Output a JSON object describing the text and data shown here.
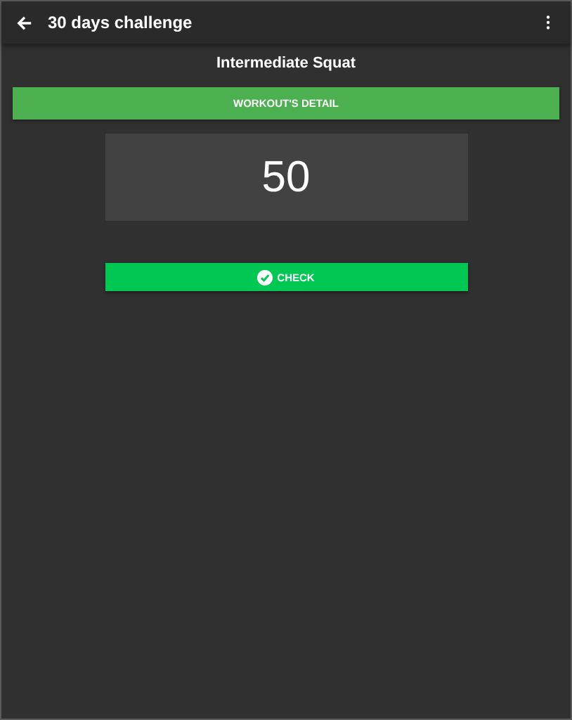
{
  "toolbar": {
    "title": "30 days challenge"
  },
  "workout": {
    "name": "Intermediate Squat",
    "detail_button": "WORKOUT'S DETAIL",
    "count": "50",
    "check_button": "CHECK"
  }
}
